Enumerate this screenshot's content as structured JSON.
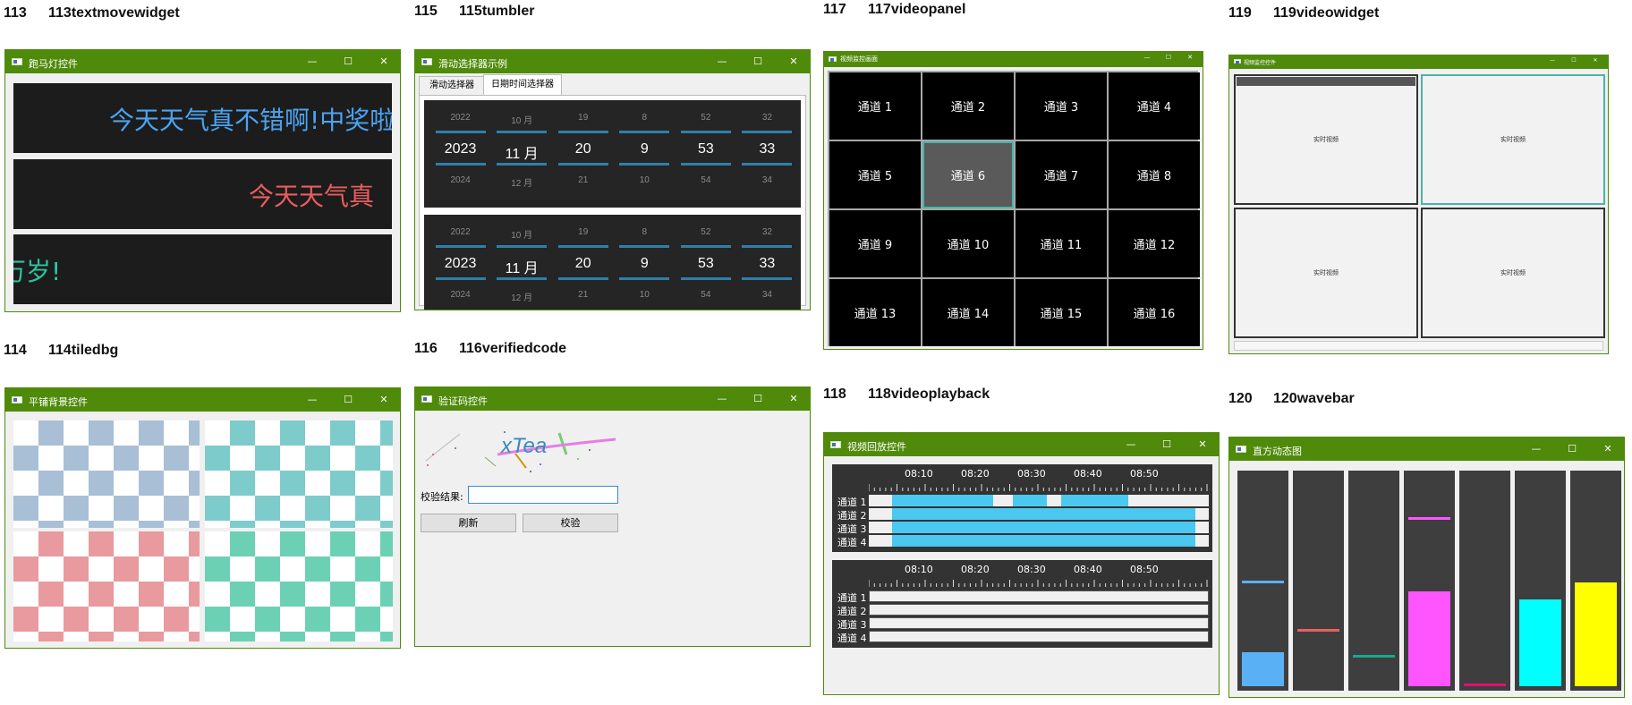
{
  "captions": [
    {
      "num": "113",
      "name": "113textmovewidget"
    },
    {
      "num": "115",
      "name": "115tumbler"
    },
    {
      "num": "117",
      "name": "117videopanel"
    },
    {
      "num": "119",
      "name": "119videowidget"
    },
    {
      "num": "114",
      "name": "114tiledbg"
    },
    {
      "num": "116",
      "name": "116verifiedcode"
    },
    {
      "num": "118",
      "name": "118videoplayback"
    },
    {
      "num": "120",
      "name": "120wavebar"
    }
  ],
  "window_buttons": {
    "minimize": "—",
    "maximize": "☐",
    "close": "✕"
  },
  "marquee": {
    "title": "跑马灯控件",
    "lines": [
      {
        "text": "今天天气真不错啊!中奖啦!",
        "color": "#4ba3f0"
      },
      {
        "text": "今天天气真",
        "color": "#e85d5d"
      },
      {
        "text": "万岁!",
        "color": "#2ec4a0"
      }
    ]
  },
  "tumbler": {
    "title": "滑动选择器示例",
    "tabs": [
      "滑动选择器",
      "日期时间选择器"
    ],
    "columns": [
      {
        "prev": "2022",
        "cur": "2023",
        "next": "2024"
      },
      {
        "prev": "10 月",
        "cur": "11 月",
        "next": "12 月"
      },
      {
        "prev": "19",
        "cur": "20",
        "next": "21"
      },
      {
        "prev": "8",
        "cur": "9",
        "next": "10"
      },
      {
        "prev": "52",
        "cur": "53",
        "next": "54"
      },
      {
        "prev": "32",
        "cur": "33",
        "next": "34"
      }
    ]
  },
  "videopanel": {
    "title": "视频监控画面",
    "channels": [
      "通道 1",
      "通道 2",
      "通道 3",
      "通道 4",
      "通道 5",
      "通道 6",
      "通道 7",
      "通道 8",
      "通道 9",
      "通道 10",
      "通道 11",
      "通道 12",
      "通道 13",
      "通道 14",
      "通道 15",
      "通道 16"
    ],
    "selected_index": 5,
    "highlight": "#48b5a8"
  },
  "videowidget": {
    "title": "视频监控控件",
    "cell_label": "实时视频",
    "highlight": "#48b5a8"
  },
  "tiledbg": {
    "title": "平铺背景控件",
    "colors": [
      "#a8bfd6",
      "#7ecbcb",
      "#e89a9e",
      "#6cd1b4"
    ]
  },
  "verifiedcode": {
    "title": "验证码控件",
    "code": "xTea",
    "result_label": "校验结果:",
    "input_value": "",
    "refresh_label": "刷新",
    "verify_label": "校验"
  },
  "videoplayback": {
    "title": "视频回放控件",
    "ticks": [
      "08:10",
      "08:20",
      "08:30",
      "08:40",
      "08:50"
    ],
    "channels": [
      "通道 1",
      "通道 2",
      "通道 3",
      "通道 4"
    ]
  },
  "wavebar": {
    "title": "直方动态图",
    "bars": [
      {
        "level": 0.16,
        "peak": 0.5,
        "color": "#5ab0f5"
      },
      {
        "level": 0.0,
        "peak": 0.27,
        "color": "#e8605e"
      },
      {
        "level": 0.0,
        "peak": 0.15,
        "color": "#18a890"
      },
      {
        "level": 0.45,
        "peak": 0.8,
        "color": "#ff55ff"
      },
      {
        "level": 0.0,
        "peak": 0.0,
        "color": "#e01070"
      },
      {
        "level": 0.41,
        "peak": 0.0,
        "color": "#00ffff"
      },
      {
        "level": 0.49,
        "peak": 0.0,
        "color": "#ffff00"
      }
    ]
  }
}
